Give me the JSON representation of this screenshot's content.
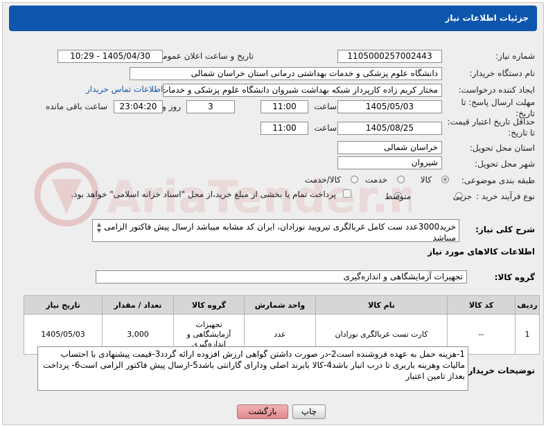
{
  "header": {
    "title": "جزئیات اطلاعات نیاز"
  },
  "watermark": {
    "text": "AriaTender.neT"
  },
  "need_number": {
    "label": "شماره نیاز:",
    "value": "1105000257002443"
  },
  "announce": {
    "label": "تاریخ و ساعت اعلان عمومی:",
    "value": "1405/04/30 - 10:29"
  },
  "buyer_org": {
    "label": "نام دستگاه خریدار:",
    "value": "دانشگاه علوم پزشکی و خدمات بهداشتی درمانی استان خراسان شمالی"
  },
  "creator": {
    "label": "ایجاد کننده درخواست:",
    "value": "مختار کریم زاده کارپرداز شبکه بهداشت شیروان دانشگاه علوم پزشکی و خدمات",
    "contact_link": "اطلاعات تماس خریدار"
  },
  "deadline": {
    "label_line1": "مهلت ارسال پاسخ: تا",
    "label_line2": "تاریخ:",
    "date": "1405/05/03",
    "time_label": "ساعت",
    "time": "11:00",
    "days": "3",
    "days_label": "روز و",
    "remaining": "23:04:20",
    "remaining_label": "ساعت باقی مانده"
  },
  "validity": {
    "label_line1": "حداقل تاریخ اعتبار قیمت:",
    "label_line2": "تا تاریخ:",
    "date": "1405/08/25",
    "time_label": "ساعت",
    "time": "11:00"
  },
  "province": {
    "label": "استان محل تحویل:",
    "value": "خراسان شمالی"
  },
  "city": {
    "label": "شهر محل تحویل:",
    "value": "شیروان"
  },
  "category": {
    "label": "طبقه بندی موضوعی:",
    "options": [
      "کالا",
      "خدمت",
      "کالا/خدمت"
    ],
    "selected": "کالا"
  },
  "purchase_type": {
    "label": "نوع فرآیند خرید :",
    "options": [
      "جزیی",
      "متوسط"
    ],
    "selected": "متوسط",
    "note": "پرداخت تمام یا بخشی از مبلغ خرید،از محل \"اسناد خزانه اسلامی\" خواهد بود."
  },
  "description": {
    "label": "شرح کلی نیاز:",
    "text": "خرید3000عدد ست کامل غربالگری تیرویید نوزادان، ایران کد مشابه میباشد ارسال پیش فاکتور الزامی میباشد"
  },
  "goods_section": {
    "title": "اطلاعات کالاهای مورد نیاز"
  },
  "goods_group": {
    "label": "گروه کالا:",
    "value": "تجهیزات آزمایشگاهی و اندازه‌گیری"
  },
  "items_table": {
    "headers": [
      "ردیف",
      "کد کالا",
      "نام کالا",
      "واحد شمارش",
      "گروه کالا",
      "تعداد / مقدار",
      "تاریخ نیاز"
    ],
    "rows": [
      {
        "row": "1",
        "code": "--",
        "name": "کارت تست غربالگری نوزادان",
        "unit": "عدد",
        "group": "تجهیزات آزمایشگاهی و اندازه‌گیری",
        "qty": "3,000",
        "date": "1405/05/03"
      }
    ]
  },
  "buyer_notes": {
    "label": "توضیحات خریدار:",
    "text": "1-هزینه حمل به عهده فروشنده است2-در صورت داشتن گواهی ارزش افزوده ارائه گردد3-قیمت پیشنهادی با احتساب مالیات وهزینه باربری تا درب انبار  باشد4-کالا بابرند اصلی ودارای گارانتی باشد5-ارسال پیش فاکتور الزامی است6- پرداخت بعداز تامین اعتبار"
  },
  "buttons": {
    "print": "چاپ",
    "back": "بازگشت"
  },
  "colors": {
    "title_bg": "#0e56ad",
    "link": "#1a5aa8",
    "back_button_bg": "#e89a9a"
  }
}
